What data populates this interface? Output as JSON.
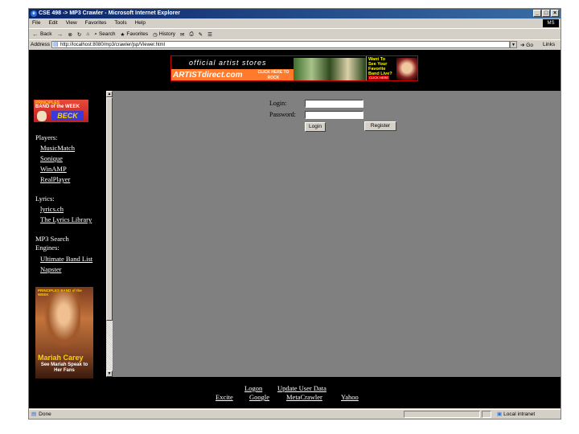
{
  "window": {
    "title": "CSE 498 -> MP3 Crawler - Microsoft Internet Explorer",
    "minimize": "_",
    "maximize": "□",
    "close": "×",
    "throbber": "MS"
  },
  "menu": [
    "File",
    "Edit",
    "View",
    "Favorites",
    "Tools",
    "Help"
  ],
  "toolbar": {
    "back": "Back",
    "forward": "→",
    "stop": "⊗",
    "refresh": "↻",
    "home": "⌂",
    "search": "Search",
    "favorites": "Favorites",
    "history": "History",
    "mail": "✉",
    "print": "⎙",
    "edit": "✎",
    "discuss": "☰"
  },
  "address": {
    "label": "Address",
    "url": "http://localhost:8080/mp3/crawler/jsp/Viewer.html",
    "go": "Go",
    "links": "Links"
  },
  "banner": {
    "line1": "official artist stores",
    "line2": "ARTISTdirect.com",
    "line3": "CLICK HERE TO ROCK",
    "right_text": "Want To See Your Favorite Band Live?",
    "click": "CLICK HERE"
  },
  "sidebar": {
    "logo_top": "PRINCIPLES",
    "logo_mid": "BAND of the WEEK",
    "logo_name": "BECK",
    "players_heading": "Players:",
    "players": [
      "MusicMatch",
      "Sonique",
      "WinAMP",
      "RealPlayer"
    ],
    "lyrics_heading": "Lyrics:",
    "lyrics": [
      "lyrics.ch",
      "The Lyrics Library"
    ],
    "search_heading_1": "MP3 Search",
    "search_heading_2": "Engines:",
    "search_engines": [
      "Ultimate Band List",
      "Napster"
    ],
    "promo_top": "PRINCIPLES BAND of the WEEK",
    "promo_name": "Mariah Carey",
    "promo_sub": "See Mariah Speak to Her Fans"
  },
  "form": {
    "login_label": "Login:",
    "password_label": "Password:",
    "login_value": "",
    "password_value": "",
    "login_button": "Login",
    "register_button": "Register"
  },
  "footer": {
    "row1": [
      "Logon",
      "Update User Data"
    ],
    "row2": [
      "Excite",
      "Google",
      "MetaCrawler",
      "Yahoo"
    ]
  },
  "status": {
    "text": "Done",
    "zone": "Local intranet"
  }
}
